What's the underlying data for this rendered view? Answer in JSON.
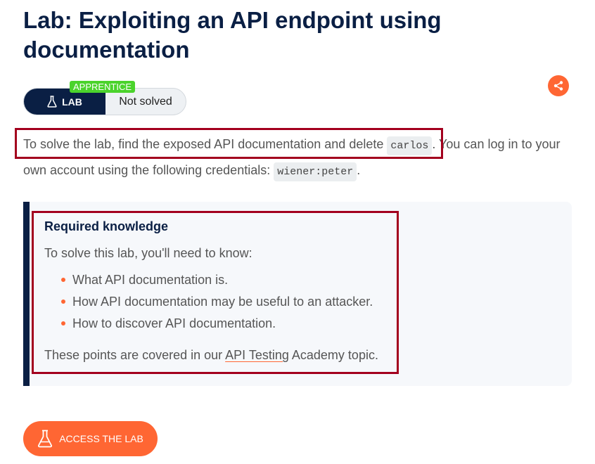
{
  "page": {
    "title": "Lab: Exploiting an API endpoint using documentation"
  },
  "badge": {
    "level": "APPRENTICE",
    "lab_label": "LAB",
    "status": "Not solved"
  },
  "share": {
    "icon": "share-icon"
  },
  "intro": {
    "text_1": "To solve the lab, find the exposed API documentation and delete ",
    "code_1": "carlos",
    "text_2": ". You can log in to your own account using the following credentials: ",
    "code_2": "wiener:peter",
    "text_3": "."
  },
  "knowledge": {
    "heading": "Required knowledge",
    "intro": "To solve this lab, you'll need to know:",
    "items": [
      "What API documentation is.",
      "How API documentation may be useful to an attacker.",
      "How to discover API documentation."
    ],
    "footer_before": "These points are covered in our ",
    "footer_link": "API Testing",
    "footer_after": " Academy topic."
  },
  "access_button": {
    "label": "ACCESS THE LAB",
    "icon": "flask-icon"
  },
  "colors": {
    "navy": "#0a1f44",
    "accent": "#ff6633",
    "badge_green": "#4bd32c",
    "highlight": "#a3001e"
  }
}
